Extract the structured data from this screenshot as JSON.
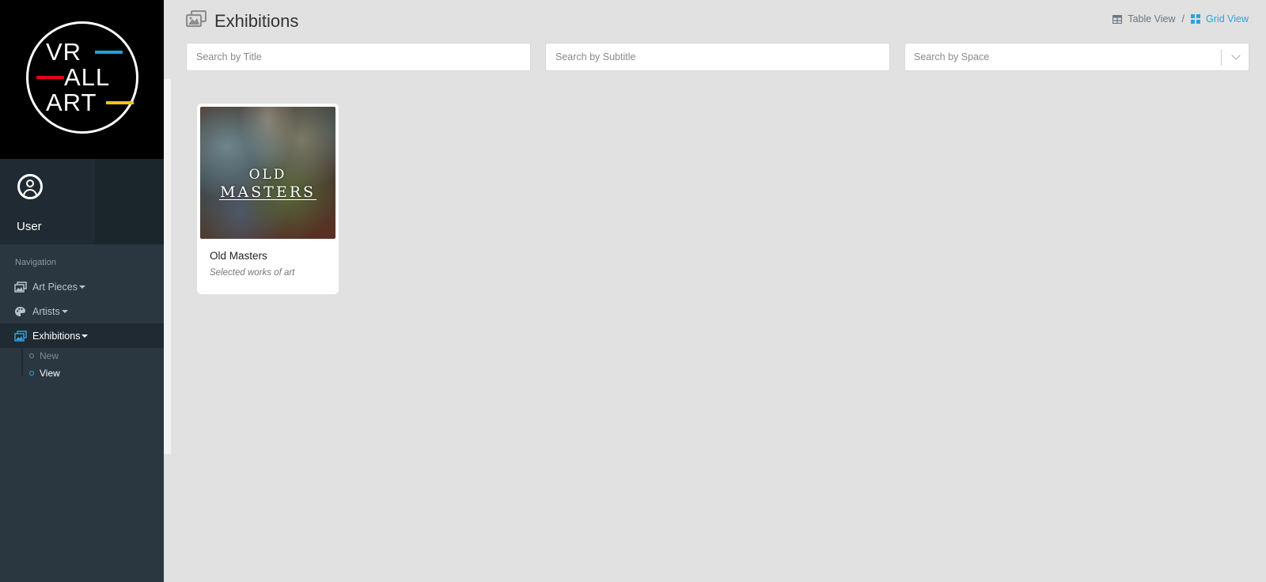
{
  "sidebar": {
    "logo": {
      "line1": "VR",
      "line2": "ALL",
      "line3": "ART"
    },
    "user": {
      "name": "User"
    },
    "nav_header": "Navigation",
    "items": [
      {
        "label": "Art Pieces",
        "icon": "images-icon"
      },
      {
        "label": "Artists",
        "icon": "palette-icon"
      },
      {
        "label": "Exhibitions",
        "icon": "gallery-icon"
      }
    ],
    "sub_items": [
      {
        "label": "New"
      },
      {
        "label": "View"
      }
    ]
  },
  "header": {
    "title": "Exhibitions",
    "title_icon": "gallery-icon",
    "breadcrumb": {
      "table_view": "Table View",
      "separator": "/",
      "grid_view": "Grid View"
    }
  },
  "filters": {
    "title_placeholder": "Search by Title",
    "subtitle_placeholder": "Search by Subtitle",
    "space_placeholder": "Search by Space"
  },
  "cards": [
    {
      "image_text_line1": "OLD",
      "image_text_line2": "MASTERS",
      "title": "Old Masters",
      "subtitle": "Selected works of art"
    }
  ],
  "colors": {
    "accent": "#2aa3e0",
    "sidebar_bg": "#2b3740",
    "main_bg": "#e1e1e1"
  }
}
